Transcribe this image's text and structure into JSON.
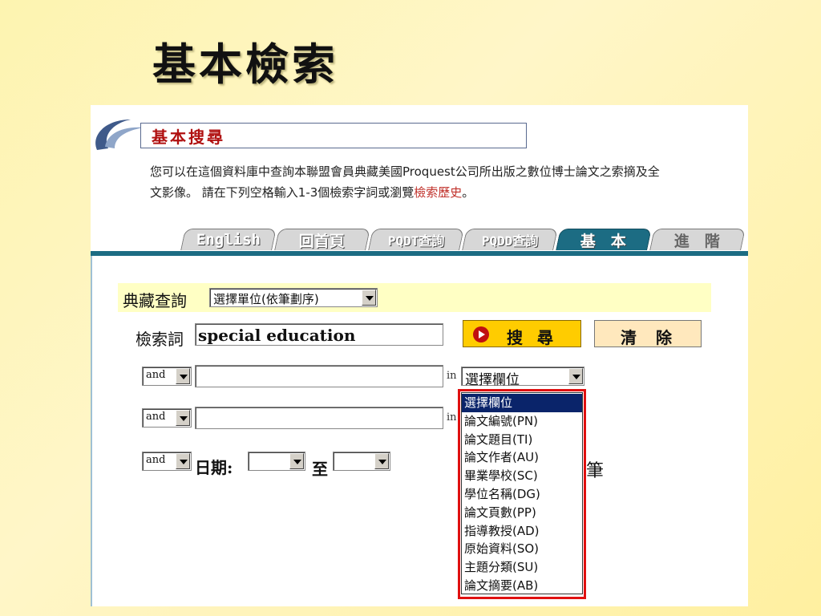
{
  "slide": {
    "title": "基本檢索"
  },
  "header": {
    "section_title": "基本搜尋",
    "intro_line1": "您可以在這個資料庫中查詢本聯盟會員典藏美國Proquest公司所出版之數位博士論文之索摘及全",
    "intro_line2_pre": "文影像。 請在下列空格輸入1-3個檢索字詞或瀏覽",
    "intro_link": "檢索歷史",
    "intro_line2_post": "。"
  },
  "tabs": [
    {
      "label": "English",
      "active": false
    },
    {
      "label": "回首頁",
      "active": false
    },
    {
      "label": "PQDT查詢",
      "active": false
    },
    {
      "label": "PQDD查詢",
      "active": false
    },
    {
      "label": "基　本",
      "active": true
    },
    {
      "label": "進　階",
      "active": false
    }
  ],
  "form": {
    "collection_label": "典藏查詢",
    "collection_select": "選擇單位(依筆劃序)",
    "keyword_label": "檢索詞",
    "keyword_value": "special education",
    "search_button": "搜尋",
    "clear_button": "清除",
    "row2": {
      "op": "and",
      "value": "",
      "in": "in",
      "field": "選擇欄位"
    },
    "row3": {
      "op": "and",
      "value": "",
      "in": "in"
    },
    "row4": {
      "op": "and",
      "date_label": "日期:",
      "to_label": "至",
      "from": "",
      "to": ""
    },
    "partial_text": "筆"
  },
  "dropdown": {
    "options": [
      "選擇欄位",
      "論文編號(PN)",
      "論文題目(TI)",
      "論文作者(AU)",
      "畢業學校(SC)",
      "學位名稱(DG)",
      "論文頁數(PP)",
      "指導教授(AD)",
      "原始資料(SO)",
      "主題分類(SU)",
      "論文摘要(AB)"
    ],
    "selected_index": 0
  },
  "colors": {
    "tab_active": "#1c6c83",
    "search_button": "#ffcc00",
    "highlight_box": "#e01010",
    "link": "#c0302a"
  }
}
